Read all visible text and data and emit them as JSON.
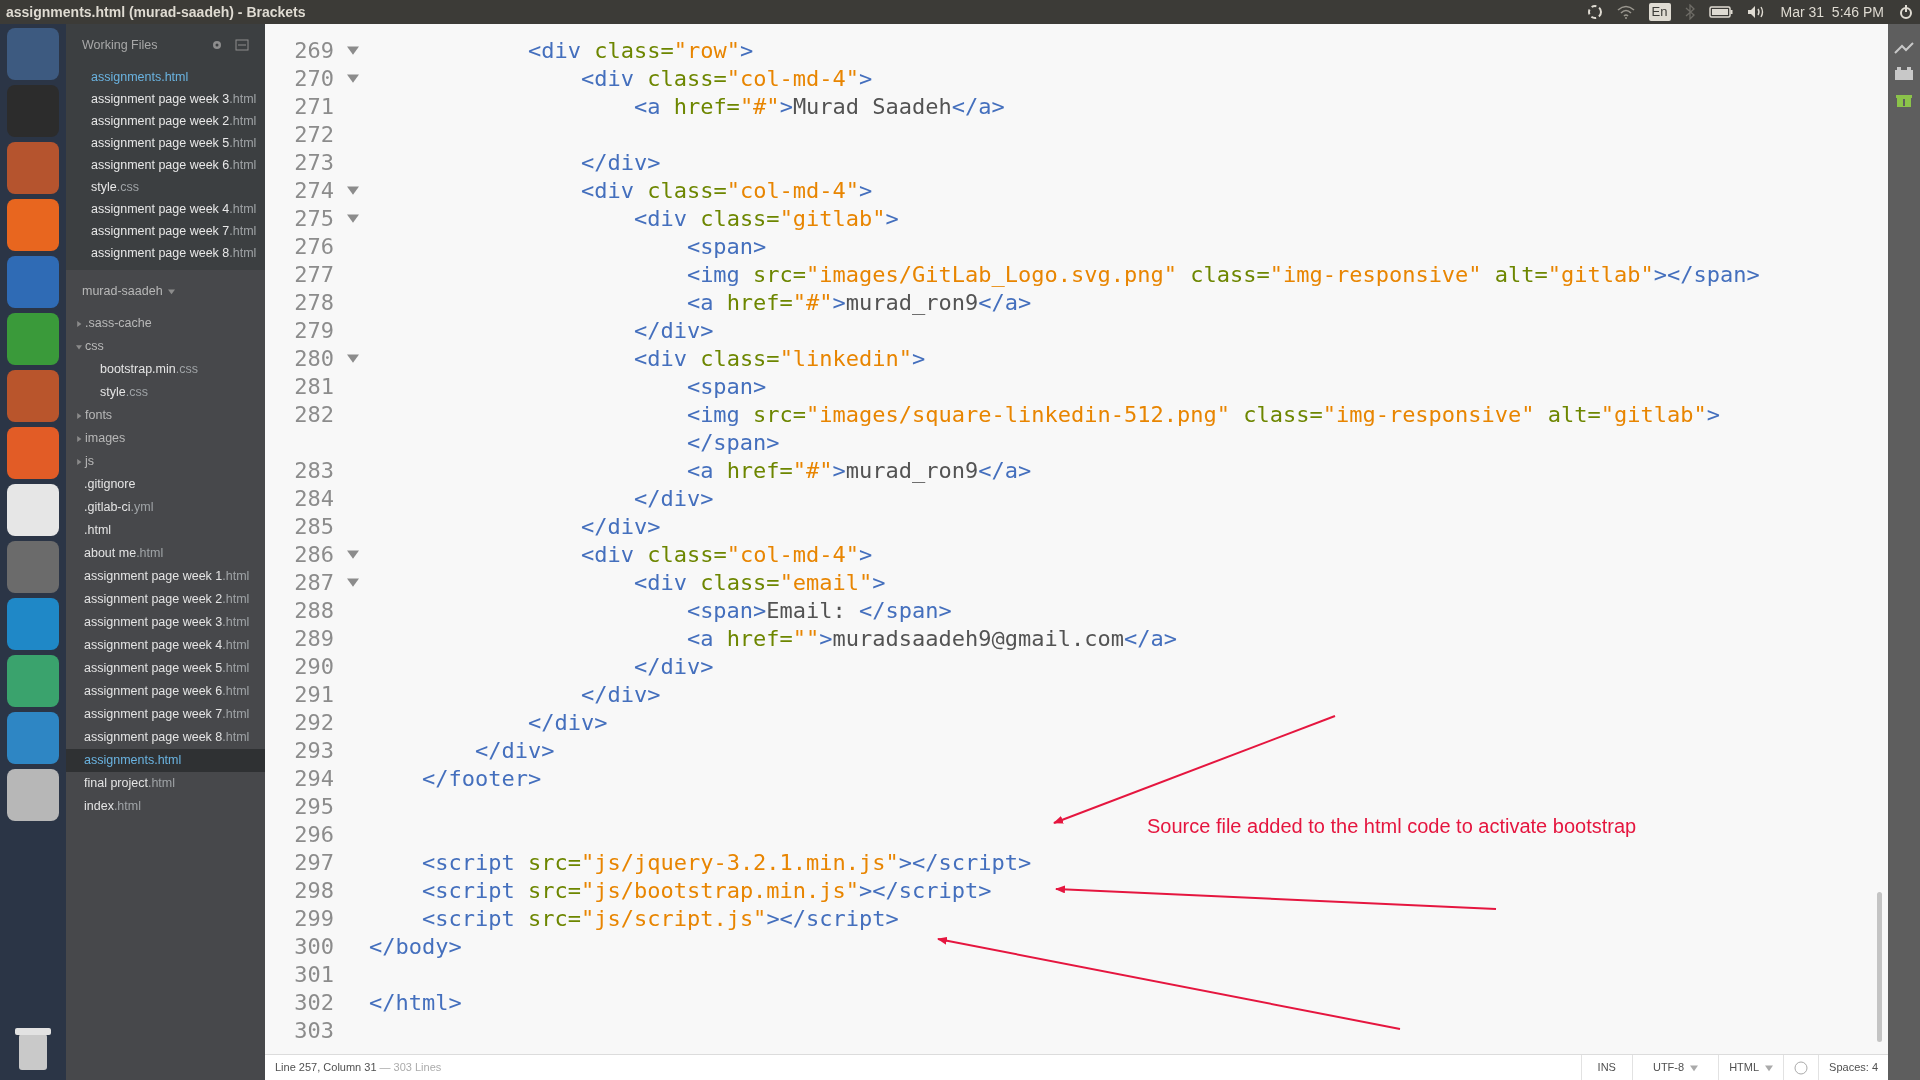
{
  "window": {
    "title": "assignments.html (murad-saadeh) - Brackets"
  },
  "top_panel": {
    "keyboard_layout": "En",
    "clock": "Mar 31  5:46 PM"
  },
  "working_files": {
    "title": "Working Files",
    "items": [
      {
        "name": "assignments",
        "ext": ".html",
        "selected": true
      },
      {
        "name": "assignment page week 3",
        "ext": ".html",
        "selected": false
      },
      {
        "name": "assignment page week 2",
        "ext": ".html",
        "selected": false
      },
      {
        "name": "assignment page week 5",
        "ext": ".html",
        "selected": false
      },
      {
        "name": "assignment page week 6",
        "ext": ".html",
        "selected": false
      },
      {
        "name": "style",
        "ext": ".css",
        "selected": false
      },
      {
        "name": "assignment page week 4",
        "ext": ".html",
        "selected": false
      },
      {
        "name": "assignment page week 7",
        "ext": ".html",
        "selected": false
      },
      {
        "name": "assignment page week 8",
        "ext": ".html",
        "selected": false
      }
    ]
  },
  "project": {
    "title": "murad-saadeh",
    "items": [
      {
        "kind": "folder",
        "name": ".sass-cache",
        "expanded": false
      },
      {
        "kind": "folder",
        "name": "css",
        "expanded": true,
        "children": [
          {
            "kind": "file",
            "name": "bootstrap.min",
            "ext": ".css",
            "selected": false
          },
          {
            "kind": "file",
            "name": "style",
            "ext": ".css",
            "selected": false
          }
        ]
      },
      {
        "kind": "folder",
        "name": "fonts",
        "expanded": false
      },
      {
        "kind": "folder",
        "name": "images",
        "expanded": false
      },
      {
        "kind": "folder",
        "name": "js",
        "expanded": false
      },
      {
        "kind": "file",
        "name": ".gitignore",
        "selected": false
      },
      {
        "kind": "file",
        "name": ".gitlab-ci",
        "ext": ".yml",
        "selected": false
      },
      {
        "kind": "file",
        "name": ".html",
        "selected": false
      },
      {
        "kind": "file",
        "name": "about me",
        "ext": ".html",
        "selected": false
      },
      {
        "kind": "file",
        "name": "assignment page week 1",
        "ext": ".html",
        "selected": false
      },
      {
        "kind": "file",
        "name": "assignment page week 2",
        "ext": ".html",
        "selected": false
      },
      {
        "kind": "file",
        "name": "assignment page week 3",
        "ext": ".html",
        "selected": false
      },
      {
        "kind": "file",
        "name": "assignment page week 4",
        "ext": ".html",
        "selected": false
      },
      {
        "kind": "file",
        "name": "assignment page week 5",
        "ext": ".html",
        "selected": false
      },
      {
        "kind": "file",
        "name": "assignment page week 6",
        "ext": ".html",
        "selected": false
      },
      {
        "kind": "file",
        "name": "assignment page week 7",
        "ext": ".html",
        "selected": false
      },
      {
        "kind": "file",
        "name": "assignment page week 8",
        "ext": ".html",
        "selected": false
      },
      {
        "kind": "file",
        "name": "assignments",
        "ext": ".html",
        "selected": true
      },
      {
        "kind": "file",
        "name": "final project",
        "ext": ".html",
        "selected": false
      },
      {
        "kind": "file",
        "name": "index",
        "ext": ".html",
        "selected": false
      }
    ]
  },
  "editor": {
    "lines": [
      {
        "number": "269",
        "foldable": true,
        "tokens": [
          {
            "kind": "tag",
            "text": "            <div "
          },
          {
            "kind": "attr",
            "text": "class="
          },
          {
            "kind": "str",
            "text": "\"row\""
          },
          {
            "kind": "tag",
            "text": ">"
          }
        ]
      },
      {
        "number": "270",
        "foldable": true,
        "tokens": [
          {
            "kind": "tag",
            "text": "                <div "
          },
          {
            "kind": "attr",
            "text": "class="
          },
          {
            "kind": "str",
            "text": "\"col-md-4\""
          },
          {
            "kind": "tag",
            "text": ">"
          }
        ]
      },
      {
        "number": "271",
        "foldable": false,
        "tokens": [
          {
            "kind": "tag",
            "text": "                    <a "
          },
          {
            "kind": "attr",
            "text": "href="
          },
          {
            "kind": "str",
            "text": "\"#\""
          },
          {
            "kind": "tag",
            "text": ">"
          },
          {
            "kind": "text",
            "text": "Murad Saadeh"
          },
          {
            "kind": "tag",
            "text": "</a>"
          }
        ]
      },
      {
        "number": "272",
        "foldable": false
      },
      {
        "number": "273",
        "foldable": false,
        "tokens": [
          {
            "kind": "tag",
            "text": "                </div>"
          }
        ]
      },
      {
        "number": "274",
        "foldable": true,
        "tokens": [
          {
            "kind": "tag",
            "text": "                <div "
          },
          {
            "kind": "attr",
            "text": "class="
          },
          {
            "kind": "str",
            "text": "\"col-md-4\""
          },
          {
            "kind": "tag",
            "text": ">"
          }
        ]
      },
      {
        "number": "275",
        "foldable": true,
        "tokens": [
          {
            "kind": "tag",
            "text": "                    <div "
          },
          {
            "kind": "attr",
            "text": "class="
          },
          {
            "kind": "str",
            "text": "\"gitlab\""
          },
          {
            "kind": "tag",
            "text": ">"
          }
        ]
      },
      {
        "number": "276",
        "foldable": false,
        "tokens": [
          {
            "kind": "tag",
            "text": "                        <span>"
          }
        ]
      },
      {
        "number": "277",
        "foldable": false,
        "tokens": [
          {
            "kind": "tag",
            "text": "                        <img "
          },
          {
            "kind": "attr",
            "text": "src="
          },
          {
            "kind": "str",
            "text": "\"images/GitLab_Logo.svg.png\""
          },
          {
            "kind": "attr",
            "text": " class="
          },
          {
            "kind": "str",
            "text": "\"img-responsive\""
          },
          {
            "kind": "attr",
            "text": " alt="
          },
          {
            "kind": "str",
            "text": "\"gitlab\""
          },
          {
            "kind": "tag",
            "text": "></span>"
          }
        ]
      },
      {
        "number": "278",
        "foldable": false,
        "tokens": [
          {
            "kind": "tag",
            "text": "                        <a "
          },
          {
            "kind": "attr",
            "text": "href="
          },
          {
            "kind": "str",
            "text": "\"#\""
          },
          {
            "kind": "tag",
            "text": ">"
          },
          {
            "kind": "text",
            "text": "murad_ron9"
          },
          {
            "kind": "tag",
            "text": "</a>"
          }
        ]
      },
      {
        "number": "279",
        "foldable": false,
        "tokens": [
          {
            "kind": "tag",
            "text": "                    </div>"
          }
        ]
      },
      {
        "number": "280",
        "foldable": true,
        "tokens": [
          {
            "kind": "tag",
            "text": "                    <div "
          },
          {
            "kind": "attr",
            "text": "class="
          },
          {
            "kind": "str",
            "text": "\"linkedin\""
          },
          {
            "kind": "tag",
            "text": ">"
          }
        ]
      },
      {
        "number": "281",
        "foldable": false,
        "tokens": [
          {
            "kind": "tag",
            "text": "                        <span>"
          }
        ]
      },
      {
        "number": "282",
        "foldable": false,
        "tokens": [
          {
            "kind": "tag",
            "text": "                        <img "
          },
          {
            "kind": "attr",
            "text": "src="
          },
          {
            "kind": "str",
            "text": "\"images/square-linkedin-512.png\""
          },
          {
            "kind": "attr",
            "text": " class="
          },
          {
            "kind": "str",
            "text": "\"img-responsive\""
          },
          {
            "kind": "attr",
            "text": " alt="
          },
          {
            "kind": "str",
            "text": "\"gitlab\""
          },
          {
            "kind": "tag",
            "text": ">"
          }
        ],
        "wrapped": [
          {
            "kind": "tag",
            "text": "                        </span>"
          }
        ]
      },
      {
        "number": "283",
        "foldable": false,
        "tokens": [
          {
            "kind": "tag",
            "text": "                        <a "
          },
          {
            "kind": "attr",
            "text": "href="
          },
          {
            "kind": "str",
            "text": "\"#\""
          },
          {
            "kind": "tag",
            "text": ">"
          },
          {
            "kind": "text",
            "text": "murad_ron9"
          },
          {
            "kind": "tag",
            "text": "</a>"
          }
        ]
      },
      {
        "number": "284",
        "foldable": false,
        "tokens": [
          {
            "kind": "tag",
            "text": "                    </div>"
          }
        ]
      },
      {
        "number": "285",
        "foldable": false,
        "tokens": [
          {
            "kind": "tag",
            "text": "                </div>"
          }
        ]
      },
      {
        "number": "286",
        "foldable": true,
        "tokens": [
          {
            "kind": "tag",
            "text": "                <div "
          },
          {
            "kind": "attr",
            "text": "class="
          },
          {
            "kind": "str",
            "text": "\"col-md-4\""
          },
          {
            "kind": "tag",
            "text": ">"
          }
        ]
      },
      {
        "number": "287",
        "foldable": true,
        "tokens": [
          {
            "kind": "tag",
            "text": "                    <div "
          },
          {
            "kind": "attr",
            "text": "class="
          },
          {
            "kind": "str",
            "text": "\"email\""
          },
          {
            "kind": "tag",
            "text": ">"
          }
        ]
      },
      {
        "number": "288",
        "foldable": false,
        "tokens": [
          {
            "kind": "tag",
            "text": "                        <span>"
          },
          {
            "kind": "text",
            "text": "Email: "
          },
          {
            "kind": "tag",
            "text": "</span>"
          }
        ]
      },
      {
        "number": "289",
        "foldable": false,
        "tokens": [
          {
            "kind": "tag",
            "text": "                        <a "
          },
          {
            "kind": "attr",
            "text": "href="
          },
          {
            "kind": "str",
            "text": "\"\""
          },
          {
            "kind": "tag",
            "text": ">"
          },
          {
            "kind": "text",
            "text": "muradsaadeh9@gmail.com"
          },
          {
            "kind": "tag",
            "text": "</a>"
          }
        ]
      },
      {
        "number": "290",
        "foldable": false,
        "tokens": [
          {
            "kind": "tag",
            "text": "                    </div>"
          }
        ]
      },
      {
        "number": "291",
        "foldable": false,
        "tokens": [
          {
            "kind": "tag",
            "text": "                </div>"
          }
        ]
      },
      {
        "number": "292",
        "foldable": false,
        "tokens": [
          {
            "kind": "tag",
            "text": "            </div>"
          }
        ]
      },
      {
        "number": "293",
        "foldable": false,
        "tokens": [
          {
            "kind": "tag",
            "text": "        </div>"
          }
        ]
      },
      {
        "number": "294",
        "foldable": false,
        "tokens": [
          {
            "kind": "tag",
            "text": "    </footer>"
          }
        ]
      },
      {
        "number": "295",
        "foldable": false
      },
      {
        "number": "296",
        "foldable": false
      },
      {
        "number": "297",
        "foldable": false,
        "tokens": [
          {
            "kind": "tag",
            "text": "    <script "
          },
          {
            "kind": "attr",
            "text": "src="
          },
          {
            "kind": "str",
            "text": "\"js/jquery-3.2.1.min.js\""
          },
          {
            "kind": "tag",
            "text": "></script>"
          }
        ]
      },
      {
        "number": "298",
        "foldable": false,
        "tokens": [
          {
            "kind": "tag",
            "text": "    <script "
          },
          {
            "kind": "attr",
            "text": "src="
          },
          {
            "kind": "str",
            "text": "\"js/bootstrap.min.js\""
          },
          {
            "kind": "tag",
            "text": "></script>"
          }
        ]
      },
      {
        "number": "299",
        "foldable": false,
        "tokens": [
          {
            "kind": "tag",
            "text": "    <script "
          },
          {
            "kind": "attr",
            "text": "src="
          },
          {
            "kind": "str",
            "text": "\"js/script.js\""
          },
          {
            "kind": "tag",
            "text": "></script>"
          }
        ]
      },
      {
        "number": "300",
        "foldable": false,
        "tokens": [
          {
            "kind": "tag",
            "text": "</body>"
          }
        ]
      },
      {
        "number": "301",
        "foldable": false
      },
      {
        "number": "302",
        "foldable": false,
        "tokens": [
          {
            "kind": "tag",
            "text": "</html>"
          }
        ]
      },
      {
        "number": "303",
        "foldable": false
      }
    ],
    "annotation": "Source file added to the html code to activate bootstrap"
  },
  "status_bar": {
    "position": "Line 257, Column 31",
    "line_count": "— 303 Lines",
    "mode": "INS",
    "encoding": "UTF-8",
    "language": "HTML",
    "indentation": "Spaces: 4"
  }
}
